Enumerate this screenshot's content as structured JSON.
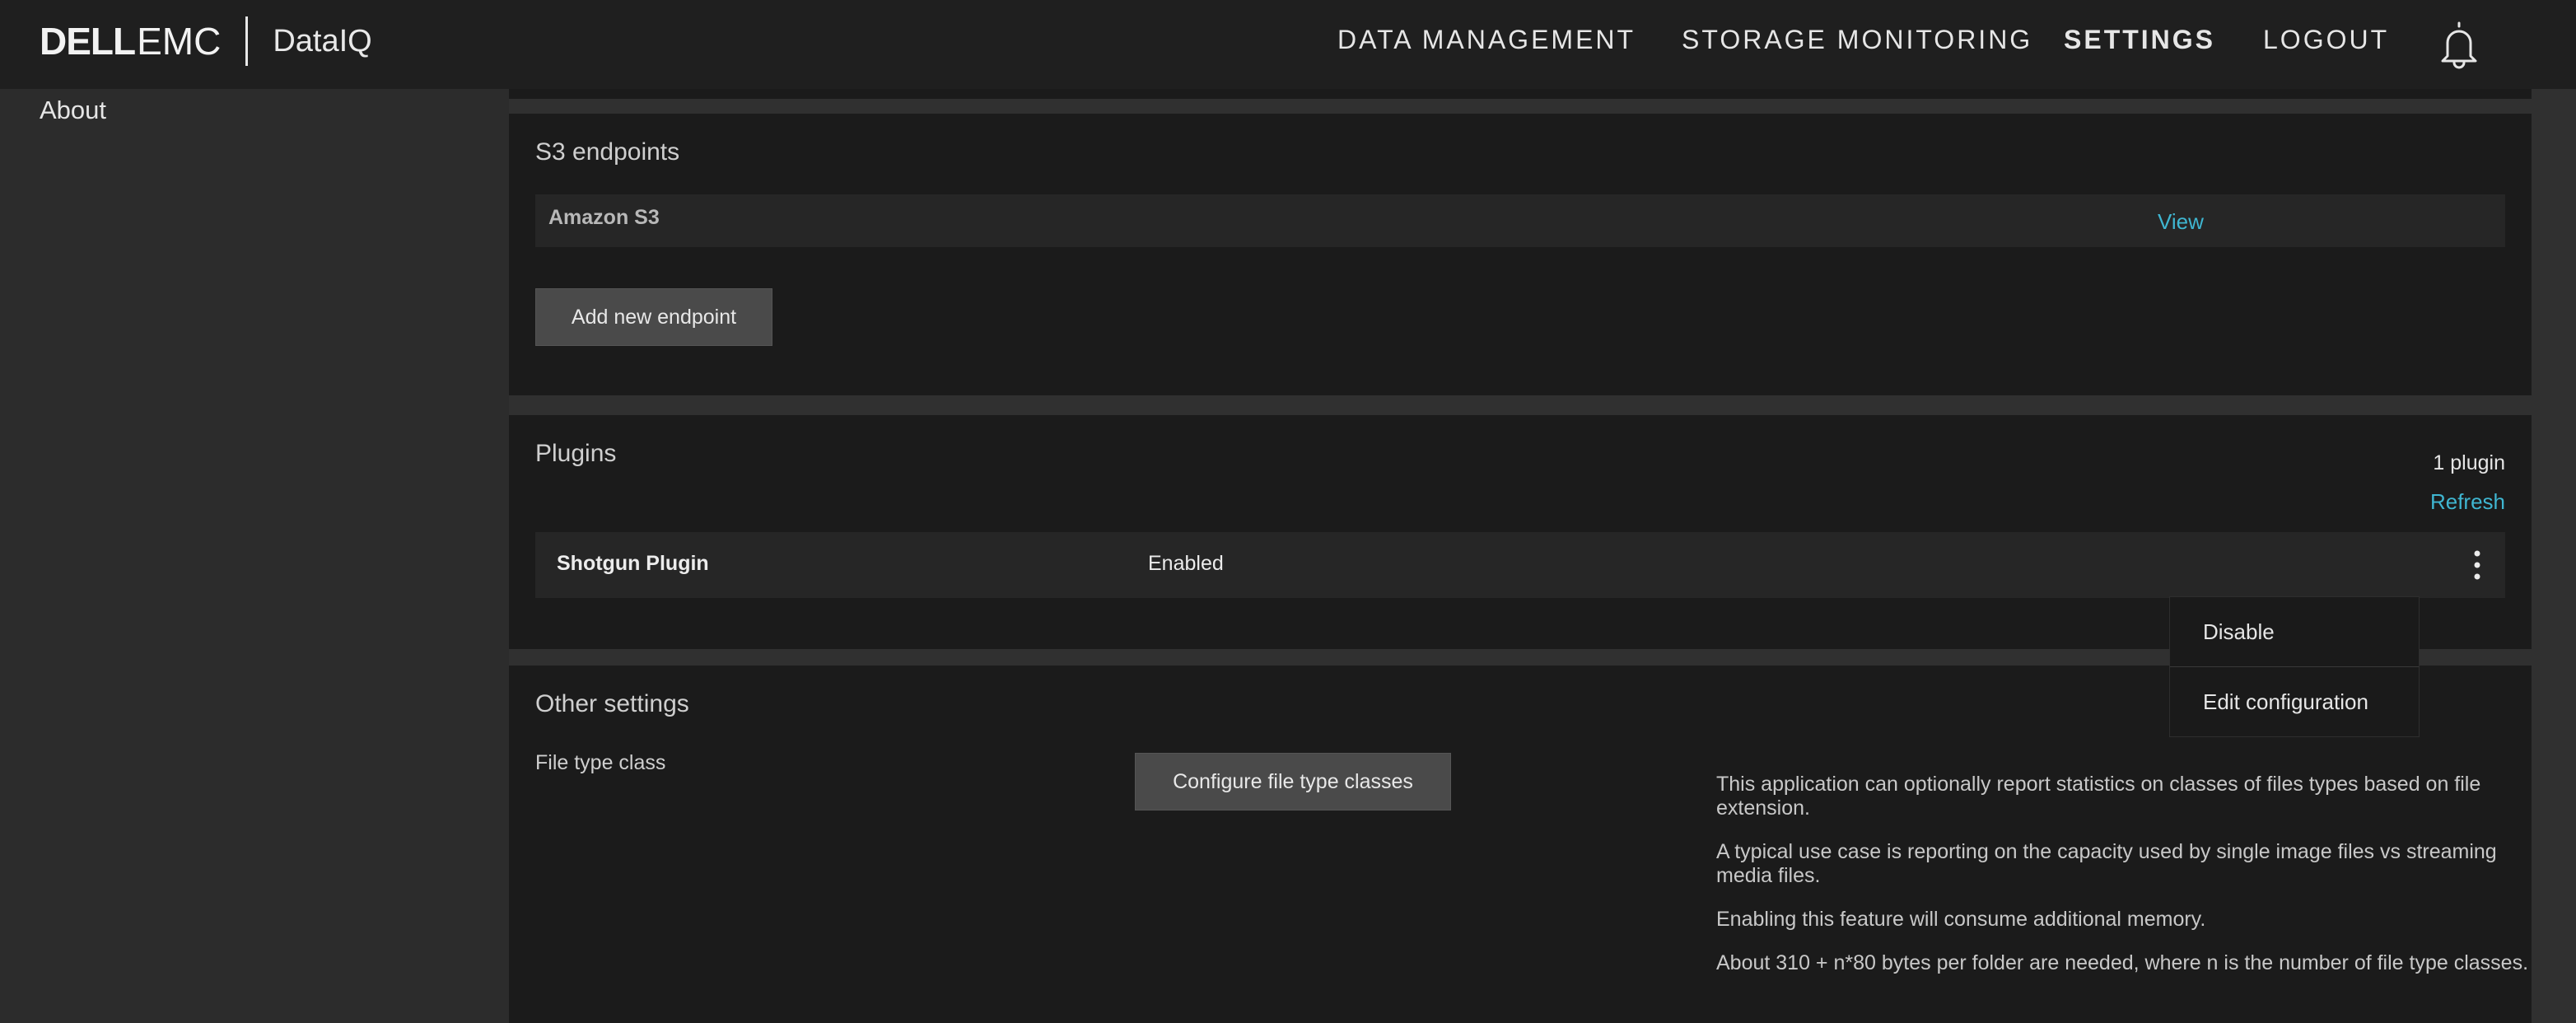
{
  "brand": {
    "dell": "DELL",
    "emc": "EMC",
    "product": "DataIQ"
  },
  "nav": {
    "data_management": "DATA MANAGEMENT",
    "storage_monitoring": "STORAGE MONITORING",
    "settings": "SETTINGS",
    "logout": "LOGOUT",
    "active": "SETTINGS"
  },
  "sidebar": {
    "items": [
      {
        "label": "About"
      }
    ]
  },
  "s3": {
    "title": "S3 endpoints",
    "endpoints": [
      {
        "name": "Amazon S3",
        "action": "View"
      }
    ],
    "add_button": "Add new endpoint"
  },
  "plugins": {
    "title": "Plugins",
    "count": "1 plugin",
    "refresh": "Refresh",
    "items": [
      {
        "name": "Shotgun Plugin",
        "status": "Enabled"
      }
    ],
    "menu": {
      "disable": "Disable",
      "edit": "Edit configuration"
    }
  },
  "other": {
    "title": "Other settings",
    "file_type_label": "File type class",
    "configure_button": "Configure file type classes",
    "description": [
      "This application can optionally report statistics on classes of files types based on file extension.",
      "A typical use case is reporting on the capacity used by single image files vs streaming media files.",
      "Enabling this feature will consume additional memory.",
      "About 310 + n*80 bytes per folder are needed, where n is the number of file type classes."
    ]
  },
  "colors": {
    "accent_link": "#3fb6d1",
    "background": "#1b1b1b",
    "panel": "#1b1b1b",
    "row": "#262626"
  }
}
